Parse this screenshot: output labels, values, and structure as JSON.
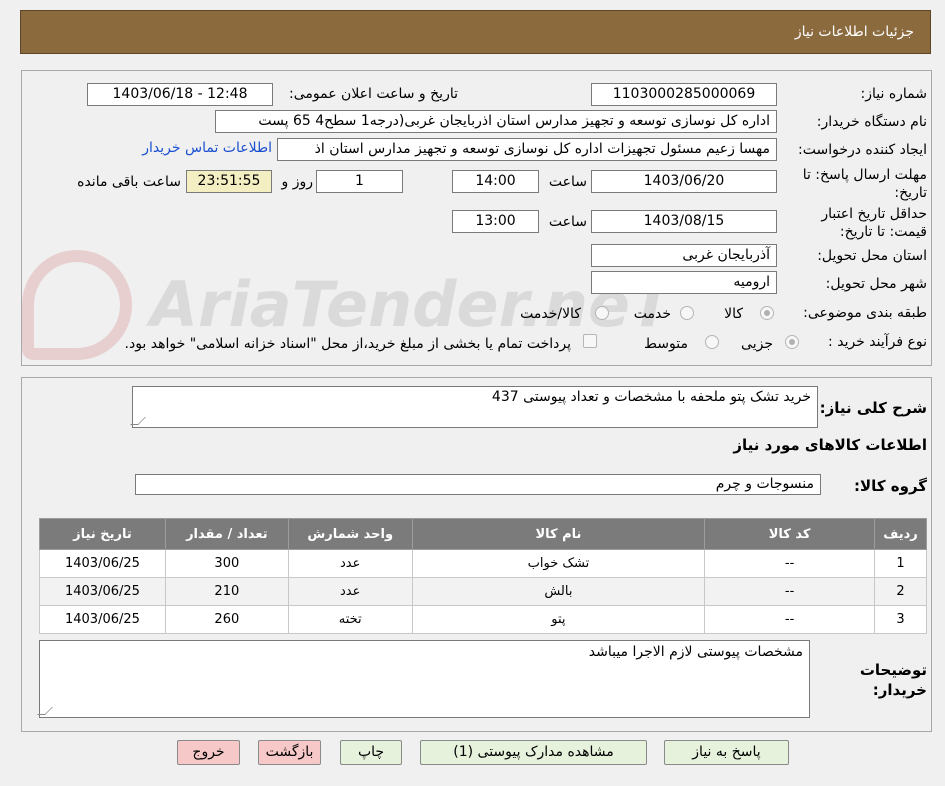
{
  "header": {
    "title": "جزئیات اطلاعات نیاز"
  },
  "watermark": "AriaTender.neT",
  "fields": {
    "need_number_label": "شماره نیاز:",
    "need_number": "1103000285000069",
    "announce_label": "تاریخ و ساعت اعلان عمومی:",
    "announce_value": "1403/06/18 - 12:48",
    "buyer_org_label": "نام دستگاه خریدار:",
    "buyer_org": "اداره کل نوسازی   توسعه و تجهیز مدارس استان اذربایجان غربی(درجه1  سطح4  65 پست",
    "requester_label": "ایجاد کننده درخواست:",
    "requester": "مهسا زعیم مسئول تجهیزات اداره کل نوسازی   توسعه و تجهیز مدارس استان اذ",
    "contact_link": "اطلاعات تماس خریدار",
    "deadline_label": "مهلت ارسال پاسخ: تا تاریخ:",
    "deadline_date": "1403/06/20",
    "time_label": "ساعت",
    "deadline_time": "14:00",
    "days": "1",
    "days_label": "روز و",
    "remaining": "23:51:55",
    "remaining_label": "ساعت باقی مانده",
    "validity_label": "حداقل تاریخ اعتبار قیمت: تا تاریخ:",
    "validity_date": "1403/08/15",
    "validity_time": "13:00",
    "province_label": "استان محل تحویل:",
    "province": "آذربایجان غربی",
    "city_label": "شهر محل تحویل:",
    "city": "ارومیه",
    "category_label": "طبقه بندی موضوعی:",
    "cat_goods": "کالا",
    "cat_service": "خدمت",
    "cat_both": "کالا/خدمت",
    "process_label": "نوع فرآیند خرید :",
    "proc_partial": "جزیی",
    "proc_medium": "متوسط",
    "payment_note": "پرداخت تمام یا بخشی از مبلغ خرید،از محل \"اسناد خزانه اسلامی\" خواهد بود."
  },
  "summary": {
    "label": "شرح کلی نیاز:",
    "value": "خرید تشک پتو ملحفه با مشخصات و تعداد پیوستی 437"
  },
  "goods_info_title": "اطلاعات کالاهای مورد نیاز",
  "goods_group": {
    "label": "گروه کالا:",
    "value": "منسوجات و چرم"
  },
  "table": {
    "headers": [
      "ردیف",
      "کد کالا",
      "نام کالا",
      "واحد شمارش",
      "تعداد / مقدار",
      "تاریخ نیاز"
    ],
    "rows": [
      [
        "1",
        "--",
        "تشک خواب",
        "عدد",
        "300",
        "1403/06/25"
      ],
      [
        "2",
        "--",
        "بالش",
        "عدد",
        "210",
        "1403/06/25"
      ],
      [
        "3",
        "--",
        "پتو",
        "تخته",
        "260",
        "1403/06/25"
      ]
    ]
  },
  "notes": {
    "label": "توضیحات خریدار:",
    "value": "مشخصات پیوستی لازم الاجرا میباشد"
  },
  "buttons": {
    "reply": "پاسخ به نیاز",
    "view_docs": "مشاهده مدارک پیوستی (1)",
    "print": "چاپ",
    "back": "بازگشت",
    "exit": "خروج"
  }
}
